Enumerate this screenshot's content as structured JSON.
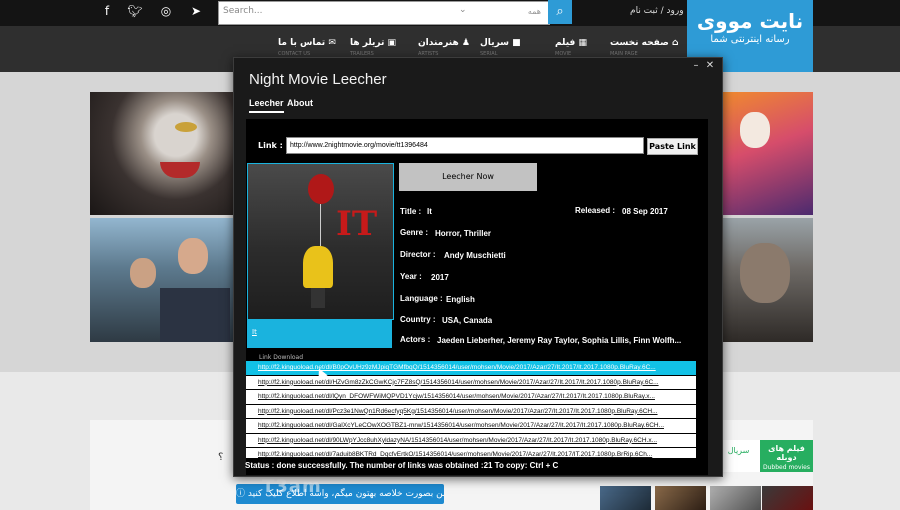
{
  "site": {
    "search_placeholder": "Search...",
    "search_category": "همه",
    "login_text": "ورود / ثبت نام",
    "logo_line1": "نایت مووی",
    "logo_line2": "رسانه اینترنتی شما",
    "nav": [
      {
        "label": "صفحه نخست",
        "sub": "MAIN PAGE"
      },
      {
        "label": "فیلم",
        "sub": "MOVIE"
      },
      {
        "label": "سریال",
        "sub": "SERIAL"
      },
      {
        "label": "هنرمندان",
        "sub": "ARTISTS"
      },
      {
        "label": "تریلر ها",
        "sub": "TRAILERS"
      },
      {
        "label": "تماس با ما",
        "sub": "CONTACT US"
      }
    ],
    "dubbed_title": "فیلم های دوبله",
    "dubbed_sub": "Dubbed movies",
    "serial_tab": "سریال",
    "bottom_question": "؟",
    "blue_button": "من بصورت خلاصه بهتون میگم، واسه اطلاع کلیک کنید",
    "watermark": "T3am"
  },
  "app": {
    "title": "Night Movie Leecher",
    "tabs": [
      "Leecher",
      "About"
    ],
    "link_label": "Link :",
    "link_value": "http://www.2nightmovie.org/movie/tt1396484",
    "paste_button": "Paste Link",
    "leech_button": "Leecher Now",
    "poster_caption": "It",
    "fields": {
      "title_label": "Title :",
      "title_value": "It",
      "released_label": "Released :",
      "released_value": "08 Sep 2017",
      "genre_label": "Genre :",
      "genre_value": "Horror, Thriller",
      "director_label": "Director :",
      "director_value": "Andy Muschietti",
      "year_label": "Year :",
      "year_value": "2017",
      "language_label": "Language :",
      "language_value": "English",
      "country_label": "Country :",
      "country_value": "USA, Canada",
      "actors_label": "Actors :",
      "actors_value": "Jaeden Lieberher, Jeremy Ray Taylor, Sophia Lillis, Finn Wolfh..."
    },
    "download_label": "Link Download",
    "download_links": [
      "http://f2.kinguoload.net/dl/B0pOvUHz9zMJpiqTGMfbqQ/1514356014/user/mohsen/Movie/2017/Azar/27/It.2017/It.2017.1080p.BluRay.6C...",
      "http://f2.kinguoload.net/dl/HZvGm8zZkCGwKCjc7FZ8sQ/1514356014/user/mohsen/Movie/2017/Azar/27/It.2017/It.2017.1080p.BluRay.6C...",
      "http://f2.kinguoload.net/dl/lQyn_DFOWFWiMQPVD1Ycjw/1514356014/user/mohsen/Movie/2017/Azar/27/It.2017/It.2017.1080p.BluRay.x...",
      "http://f2.kinguoload.net/dl/Pcz3e1NwQn1Rd6ecfyq5Kg/1514356014/user/mohsen/Movie/2017/Azar/27/It.2017/It.2017.1080p.BluRay.6CH...",
      "http://f2.kinguoload.net/dl/GaIXcYLeCOwXOGTBZ1-mrw/1514356014/user/mohsen/Movie/2017/Azar/27/It.2017/It.2017.1080p.BluRay.6CH...",
      "http://f2.kinguoload.net/dl/90LWpYJcc8uhXyldazyNA/1514356014/user/mohsen/Movie/2017/Azar/27/It.2017/It.2017.1080p.BluRay.6CH.x...",
      "http://f2.kinguoload.net/dl/7aduib8BKTRd_DqcfvErtkO/1514356014/user/mohsen/Movie/2017/Azar/27/It.2017/IT.2017.1080p.BrRip.6Ch..."
    ],
    "status": "Status :  done successfully.  The number of links was obtained :21    To copy: Ctrl + C"
  },
  "colors": {
    "accent_blue": "#12c1e6",
    "site_blue": "#2e9bd6",
    "dubbed_green": "#27ae60"
  }
}
